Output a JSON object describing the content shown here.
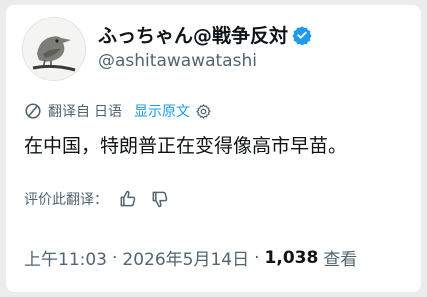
{
  "user": {
    "display_name": "ふっちゃん@戦争反対",
    "handle": "@ashitawawatashi"
  },
  "translation": {
    "translated_from": "翻译自",
    "source_language": "日语",
    "show_original": "显示原文"
  },
  "tweet": {
    "text": "在中国，特朗普正在变得像高市早苗。"
  },
  "rating": {
    "label": "评价此翻译："
  },
  "meta": {
    "time": "上午11:03",
    "dot1": "·",
    "date": "2026年5月14日",
    "dot2": "·",
    "views_count": "1,038",
    "views_label": "查看"
  },
  "icons": {
    "verified": "verified-badge-icon",
    "translate": "slash-circle-icon",
    "settings": "gear-icon",
    "like": "thumbs-up-icon",
    "dislike": "thumbs-down-icon"
  },
  "colors": {
    "accent": "#1d9bf0",
    "text": "#0f1419",
    "muted": "#536471"
  }
}
